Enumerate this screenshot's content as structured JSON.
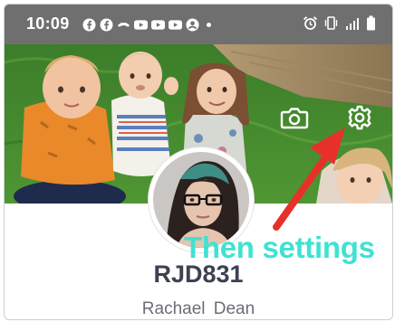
{
  "status_bar": {
    "time": "10:09",
    "notification_icons": [
      "facebook-icon",
      "facebook-icon",
      "controller-icon",
      "youtube-icon",
      "youtube-icon",
      "youtube-icon",
      "account-icon"
    ],
    "system_icons": [
      "alarm-icon",
      "vibrate-icon",
      "signal-icon",
      "battery-icon"
    ],
    "bar_color": "#6f6f70"
  },
  "profile": {
    "username": "RJD831",
    "full_name": "Rachael  Dean"
  },
  "cover": {
    "actions": [
      "camera-icon",
      "settings-gear-icon"
    ]
  },
  "annotation": {
    "text": "Then settings",
    "text_color": "#3fe2d2",
    "arrow_color": "#e8302a"
  }
}
